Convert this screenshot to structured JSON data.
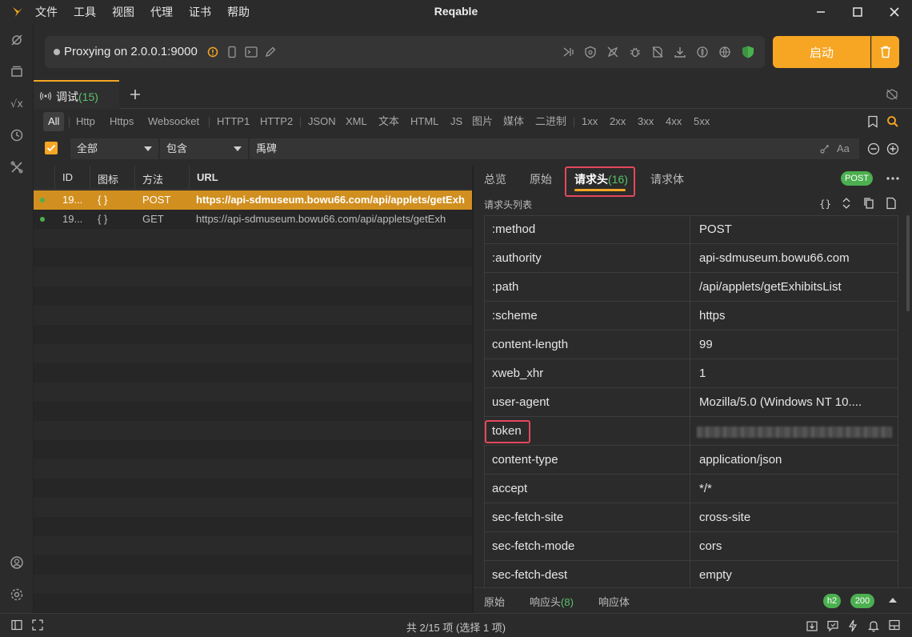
{
  "window": {
    "title": "Reqable",
    "menu": [
      "文件",
      "工具",
      "视图",
      "代理",
      "证书",
      "帮助"
    ]
  },
  "proxy": {
    "status": "Proxying on 2.0.0.1:9000",
    "start_label": "启动"
  },
  "tabs": {
    "debug_label": "调试",
    "debug_count": "(15)"
  },
  "filters": {
    "types": [
      "All",
      "Http",
      "Https",
      "Websocket"
    ],
    "protocols": [
      "HTTP1",
      "HTTP2"
    ],
    "formats": [
      "JSON",
      "XML",
      "文本",
      "HTML",
      "JS",
      "图片",
      "媒体",
      "二进制"
    ],
    "status_codes": [
      "1xx",
      "2xx",
      "3xx",
      "4xx",
      "5xx"
    ]
  },
  "search": {
    "scope": "全部",
    "match": "包含",
    "query": "禹碑",
    "case_label": "Aa"
  },
  "request_list": {
    "columns": [
      "ID",
      "图标",
      "方法",
      "URL"
    ],
    "rows": [
      {
        "id": "19...",
        "icon": "{ }",
        "method": "POST",
        "url": "https://api-sdmuseum.bowu66.com/api/applets/getExh",
        "selected": true
      },
      {
        "id": "19...",
        "icon": "{ }",
        "method": "GET",
        "url": "https://api-sdmuseum.bowu66.com/api/applets/getExh",
        "selected": false
      }
    ]
  },
  "detail": {
    "tabs": [
      "总览",
      "原始",
      "请求头",
      "请求体"
    ],
    "active_tab_count": "(16)",
    "method_badge": "POST",
    "section_title": "请求头列表",
    "headers": [
      {
        "key": ":method",
        "value": "POST"
      },
      {
        "key": ":authority",
        "value": "api-sdmuseum.bowu66.com"
      },
      {
        "key": ":path",
        "value": "/api/applets/getExhibitsList"
      },
      {
        "key": ":scheme",
        "value": "https"
      },
      {
        "key": "content-length",
        "value": "99"
      },
      {
        "key": "xweb_xhr",
        "value": "1"
      },
      {
        "key": "user-agent",
        "value": "Mozilla/5.0 (Windows NT 10...."
      },
      {
        "key": "token",
        "value": ""
      },
      {
        "key": "content-type",
        "value": "application/json"
      },
      {
        "key": "accept",
        "value": "*/*"
      },
      {
        "key": "sec-fetch-site",
        "value": "cross-site"
      },
      {
        "key": "sec-fetch-mode",
        "value": "cors"
      },
      {
        "key": "sec-fetch-dest",
        "value": "empty"
      }
    ],
    "footer": {
      "raw": "原始",
      "resp_headers": "响应头",
      "resp_headers_count": "(8)",
      "resp_body": "响应体",
      "protocol_badge": "h2",
      "status_badge": "200"
    }
  },
  "statusbar": {
    "text": "共 2/15 项 (选择 1 项)"
  },
  "colors": {
    "accent": "#f6a623",
    "selected_row": "#d18f1f",
    "success": "#4caf50",
    "highlight": "#e5475d"
  }
}
